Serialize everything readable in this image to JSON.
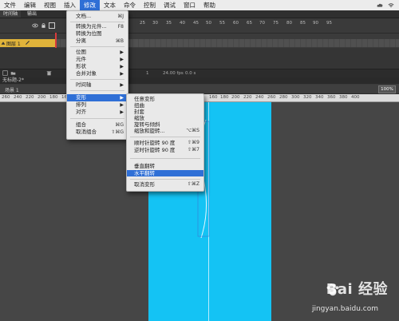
{
  "menubar": {
    "items": [
      "文件",
      "编辑",
      "视图",
      "插入",
      "修改",
      "文本",
      "命令",
      "控制",
      "调试",
      "窗口",
      "帮助"
    ],
    "active_index": 4
  },
  "timeline": {
    "tab1": "时间轴",
    "tab2": "输出",
    "layer_name": "图层 1",
    "ruler_ticks": [
      "25",
      "30",
      "35",
      "40",
      "45",
      "50",
      "55",
      "60",
      "65",
      "70",
      "75",
      "80",
      "85",
      "90",
      "95"
    ],
    "footer_frame": "1",
    "footer_fps": "24.00 fps",
    "footer_time": "0.0 s"
  },
  "document": {
    "tab_label": "无标题-2*",
    "scene_label": "场景 1",
    "zoom": "100%"
  },
  "stage_ruler_ticks": [
    "260",
    "240",
    "220",
    "200",
    "180",
    "160",
    "140",
    "120",
    "100",
    "80",
    "60",
    "40",
    "20",
    "0",
    "20",
    "40",
    "60",
    "80",
    "100",
    "120",
    "140",
    "160",
    "180",
    "200",
    "220",
    "240",
    "260",
    "280",
    "300",
    "320",
    "340",
    "360",
    "380",
    "400"
  ],
  "modify_menu": {
    "items": [
      {
        "label": "文档...",
        "shortcut": "⌘J"
      },
      {
        "label": "转换为元件...",
        "shortcut": "F8"
      },
      {
        "label": "转换为位图",
        "shortcut": ""
      },
      {
        "label": "分离",
        "shortcut": "⌘B"
      },
      {
        "label": "位图",
        "shortcut": ""
      },
      {
        "label": "元件",
        "shortcut": ""
      },
      {
        "label": "形状",
        "shortcut": ""
      },
      {
        "label": "合并对象",
        "shortcut": ""
      },
      {
        "label": "时间轴",
        "shortcut": ""
      },
      {
        "label": "变形",
        "shortcut": ""
      },
      {
        "label": "排列",
        "shortcut": ""
      },
      {
        "label": "对齐",
        "shortcut": ""
      },
      {
        "label": "组合",
        "shortcut": "⌘G"
      },
      {
        "label": "取消组合",
        "shortcut": "⇧⌘G"
      }
    ]
  },
  "transform_submenu": {
    "items": [
      {
        "label": "任意变形",
        "shortcut": ""
      },
      {
        "label": "扭曲",
        "shortcut": ""
      },
      {
        "label": "封套",
        "shortcut": ""
      },
      {
        "label": "缩放",
        "shortcut": ""
      },
      {
        "label": "旋转与倾斜",
        "shortcut": ""
      },
      {
        "label": "缩放和旋转...",
        "shortcut": "⌥⌘S"
      },
      {
        "label": "顺时针旋转 90 度",
        "shortcut": "⇧⌘9"
      },
      {
        "label": "逆时针旋转 90 度",
        "shortcut": "⇧⌘7"
      },
      {
        "label": "垂直翻转",
        "shortcut": ""
      },
      {
        "label": "水平翻转",
        "shortcut": ""
      },
      {
        "label": "取消变形",
        "shortcut": "⇧⌘Z"
      }
    ],
    "highlighted_index": 9
  },
  "watermark": {
    "brand": "Bai 经验",
    "url": "jingyan.baidu.com"
  },
  "colors": {
    "menu_highlight": "#2f6fd6",
    "stage_fill": "#14c3f4",
    "layer_highlight": "#e0b33a",
    "playhead": "#d93b3b"
  }
}
